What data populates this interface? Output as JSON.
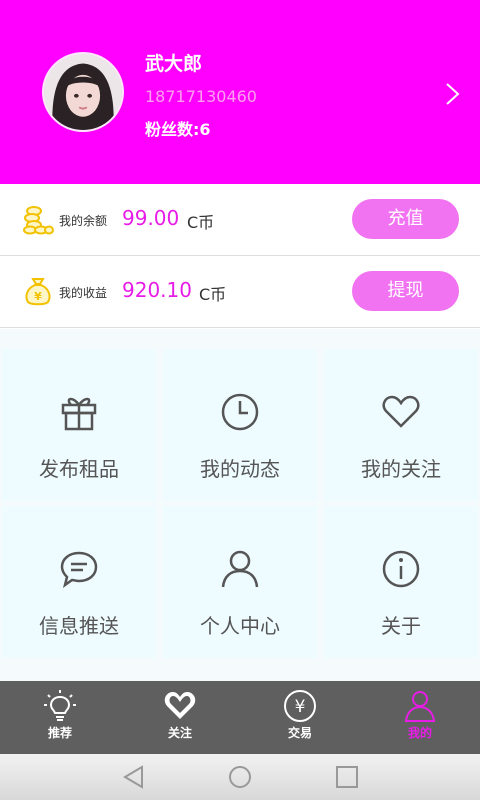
{
  "colors": {
    "header_bg": "#ff00ff",
    "accent_magenta": "#e71ce7",
    "button_pink": "#f173f1",
    "tile_bg": "#eefbff",
    "nav_bg": "#5f5f5f",
    "coin_gold": "#f2c200"
  },
  "profile": {
    "name": "武大郎",
    "phone": "18717130460",
    "fans": "粉丝数:6",
    "avatar_icon": "user-avatar-photo",
    "chevron_icon": "chevron-right-icon"
  },
  "wallet": {
    "balance": {
      "label": "我的余额",
      "amount": "99.00",
      "unit": "C币",
      "button": "充值",
      "icon": "coins-stack-icon"
    },
    "income": {
      "label": "我的收益",
      "amount": "920.10",
      "unit": "C币",
      "button": "提现",
      "icon": "money-bag-icon"
    }
  },
  "grid": [
    {
      "label": "发布租品",
      "icon": "gift-icon"
    },
    {
      "label": "我的动态",
      "icon": "clock-icon"
    },
    {
      "label": "我的关注",
      "icon": "heart-icon"
    },
    {
      "label": "信息推送",
      "icon": "chat-bubble-icon"
    },
    {
      "label": "个人中心",
      "icon": "person-icon"
    },
    {
      "label": "关于",
      "icon": "info-icon"
    }
  ],
  "nav": [
    {
      "label": "推荐",
      "icon": "lightbulb-icon",
      "active": false
    },
    {
      "label": "关注",
      "icon": "heart-icon",
      "active": false
    },
    {
      "label": "交易",
      "icon": "yen-circle-icon",
      "active": false
    },
    {
      "label": "我的",
      "icon": "person-icon",
      "active": true
    }
  ],
  "system_nav": [
    "back-icon",
    "home-icon",
    "recents-icon"
  ]
}
